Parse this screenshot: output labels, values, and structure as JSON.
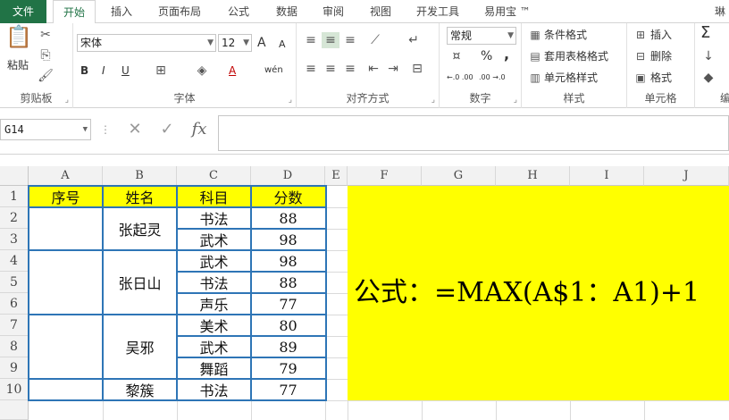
{
  "tabs": [
    "文件",
    "开始",
    "插入",
    "页面布局",
    "公式",
    "数据",
    "审阅",
    "视图",
    "开发工具",
    "易用宝 ™"
  ],
  "user_name": "琳",
  "ribbon": {
    "clipboard": {
      "label": "剪贴板",
      "paste": "粘贴"
    },
    "font": {
      "label": "字体",
      "font_name": "宋体",
      "font_size": "12",
      "bold": "B",
      "italic": "I",
      "underline": "U",
      "grow": "A",
      "shrink": "A",
      "color_a": "A",
      "phonetic": "wén"
    },
    "align": {
      "label": "对齐方式"
    },
    "number": {
      "label": "数字",
      "format": "常规",
      "percent": "%",
      "comma": ",",
      "inc": "←.0 .00",
      "dec": ".00 →.0"
    },
    "styles": {
      "label": "样式",
      "conditional": "条件格式",
      "table": "套用表格格式",
      "cell_styles": "单元格样式"
    },
    "cells": {
      "label": "单元格",
      "insert": "插入",
      "delete": "删除",
      "format": "格式"
    },
    "editing": {
      "label": "编",
      "sum": "Σ"
    }
  },
  "formula_bar": {
    "name_box": "G14",
    "cancel": "✕",
    "enter": "✓",
    "fx": "fx",
    "value": ""
  },
  "columns": [
    "A",
    "B",
    "C",
    "D",
    "E",
    "F",
    "G",
    "H",
    "I",
    "J"
  ],
  "rows": [
    "1",
    "2",
    "3",
    "4",
    "5",
    "6",
    "7",
    "8",
    "9",
    "10"
  ],
  "table": {
    "headers": [
      "序号",
      "姓名",
      "科目",
      "分数"
    ],
    "names": [
      "张起灵",
      "张日山",
      "吴邪",
      "黎簇"
    ],
    "subjects": [
      "书法",
      "武术",
      "武术",
      "书法",
      "声乐",
      "美术",
      "武术",
      "舞蹈",
      "书法"
    ],
    "scores": [
      "88",
      "98",
      "98",
      "88",
      "77",
      "80",
      "89",
      "79",
      "77"
    ]
  },
  "note": "公式：=MAX(A$1：A1)+1"
}
